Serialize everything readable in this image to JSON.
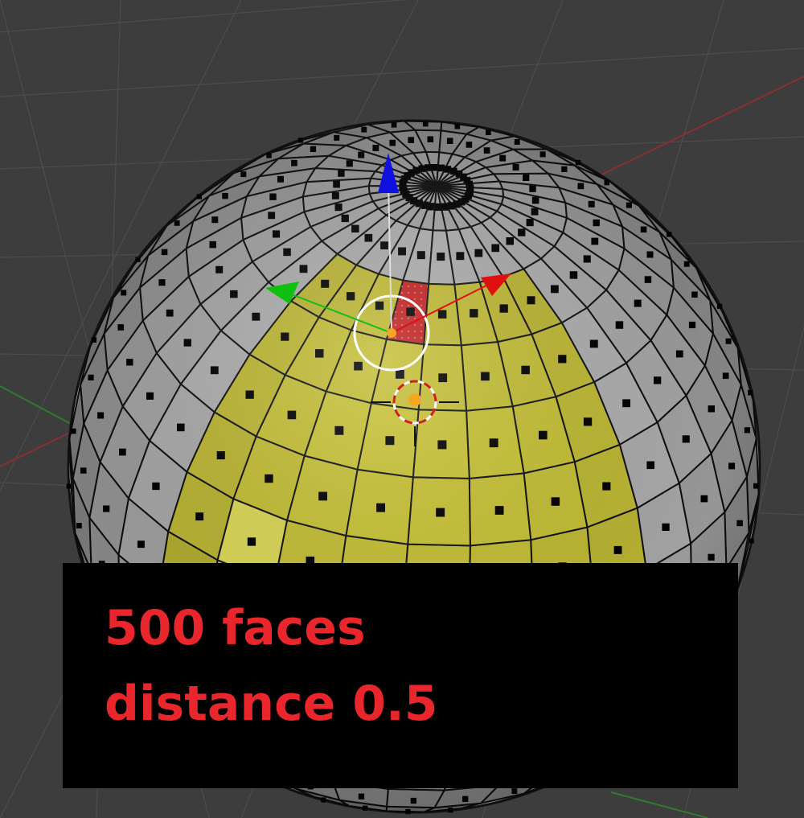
{
  "viewport": {
    "background_color": "#3d3d3d",
    "grid_color": "#4d4d4d",
    "x_axis_color": "#8a2f2f",
    "y_axis_color": "#2f7a2f"
  },
  "mesh": {
    "face_color": "#bebebe",
    "selected_face_color": "#c9c336",
    "highlight_face_color": "#e6e45a",
    "active_face_color": "#cc2222",
    "edge_color": "#111111",
    "center_dot_color": "#000000"
  },
  "gizmo": {
    "x_arrow_color": "#e01010",
    "y_arrow_color": "#10c010",
    "z_arrow_color": "#1010e0",
    "pivot_color": "#f5a623",
    "cursor_ring_colors": [
      "#ffffff",
      "#d02020"
    ]
  },
  "caption": {
    "line1": "500 faces",
    "line2": "distance 0.5",
    "text_color": "#e8262c",
    "box_color": "#000000"
  }
}
